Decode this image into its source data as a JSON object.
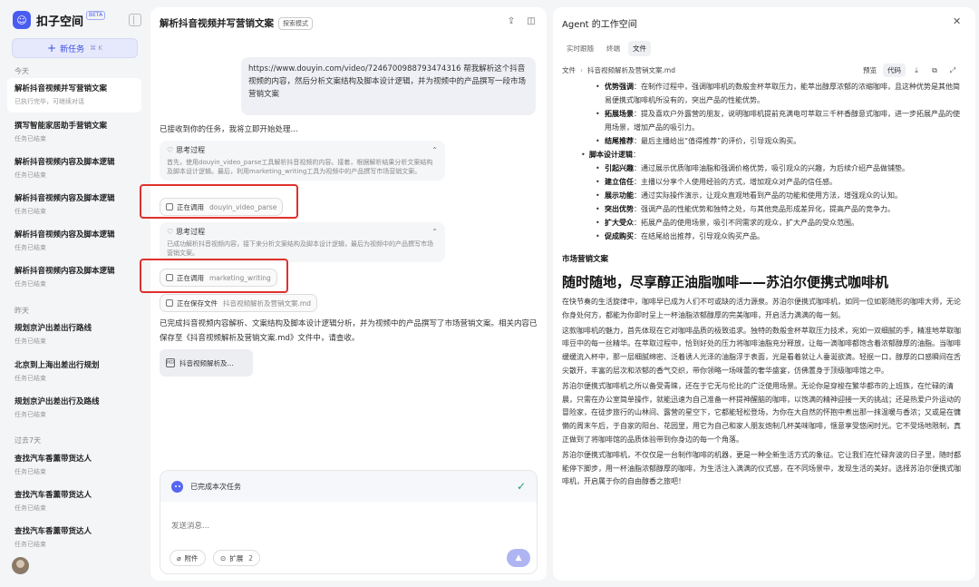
{
  "sidebar": {
    "app_name": "扣子空间",
    "beta": "BETA",
    "new_task": "新任务",
    "new_task_shortcut": "⌘ K",
    "sections": {
      "today": "今天",
      "yesterday": "昨天",
      "past7": "过去7天"
    },
    "tasks": [
      {
        "title": "解析抖音视频并写营销文案",
        "sub": "已执行完毕，可继续对话"
      },
      {
        "title": "撰写智能家居助手营销文案",
        "sub": "任务已结束"
      },
      {
        "title": "解析抖音视频内容及脚本逻辑",
        "sub": "任务已结束"
      },
      {
        "title": "解析抖音视频内容及脚本逻辑",
        "sub": "任务已结束"
      },
      {
        "title": "解析抖音视频内容及脚本逻辑",
        "sub": "任务已结束"
      },
      {
        "title": "解析抖音视频内容及脚本逻辑",
        "sub": "任务已结束"
      },
      {
        "title": "规划京沪出差出行路线",
        "sub": "任务已结束"
      },
      {
        "title": "北京到上海出差出行规划",
        "sub": "任务已结束"
      },
      {
        "title": "规划京沪出差出行及路线",
        "sub": "任务已结束"
      },
      {
        "title": "查找汽车香薰带货达人",
        "sub": "任务已结束"
      },
      {
        "title": "查找汽车香薰带货达人",
        "sub": "任务已结束"
      },
      {
        "title": "查找汽车香薰带货达人",
        "sub": "任务已结束"
      }
    ]
  },
  "chat": {
    "title": "解析抖音视频并写营销文案",
    "mode_badge": "探索模式",
    "user_message": "https://www.douyin.com/video/7246700988793474316 帮我解析这个抖音视频的内容，然后分析文案结构及脚本设计逻辑，并为视频中的产品撰写一段市场营销文案",
    "ack": "已接收到你的任务，我将立即开始处理...",
    "think1_title": "思考过程",
    "think1_body": "首先，使用douyin_video_parse工具解析抖音视频的内容。接着，根据解析结果分析文案结构及脚本设计逻辑。最后，利用marketing_writing工具为视频中的产品撰写市场营销文案。",
    "tool1_label": "正在调用",
    "tool1_name": "douyin_video_parse",
    "think2_title": "思考过程",
    "think2_body": "已成功解析抖音视频内容，接下来分析文案结构及脚本设计逻辑，最后为视频中的产品撰写市场营销文案。",
    "tool2_label": "正在调用",
    "tool2_name": "marketing_writing",
    "tool3_label": "正在保存文件",
    "tool3_name": "抖音视频解析及营销文案.md",
    "summary": "已完成抖音视频内容解析、文案结构及脚本设计逻辑分析，并为视频中的产品撰写了市场营销文案。相关内容已保存至《抖音视频解析及营销文案.md》文件中，请查收。",
    "file_card": "抖音视频解析及...",
    "status": "已完成本次任务",
    "input_placeholder": "发送消息...",
    "attach": "附件",
    "extend": "扩展",
    "extend_count": "2"
  },
  "agent": {
    "title": "Agent 的工作空间",
    "tabs": [
      "实时跟随",
      "终端",
      "文件"
    ],
    "active_tab": 2,
    "crumb_root": "文件",
    "crumb_file": "抖音视频解析及营销文案.md",
    "view_preview": "预览",
    "view_code": "代码",
    "doc": {
      "top_bullets": [
        {
          "label": "优势强调",
          "text": "：在制作过程中，强调咖啡机的数般金杯萃取压力，能萃出醇厚浓郁的浓缩咖啡，且这种优势是其他简易便携式咖啡机所没有的，突出产品的性能优势。"
        },
        {
          "label": "拓展场景",
          "text": "：提及喜欢户外露营的朋友，说明咖啡机提前充满电可萃取三千杯香醇意式咖啡，进一步拓展产品的使用场景，增加产品的吸引力。"
        },
        {
          "label": "结尾推荐",
          "text": "：最后主播给出“值得推荐”的评价，引导观众购买。"
        }
      ],
      "logic_title": "脚本设计逻辑",
      "logic_bullets": [
        {
          "label": "引起兴趣",
          "text": "：通过展示优质咖啡油脂和强调价格优势，吸引观众的兴趣，为后续介绍产品做铺垫。"
        },
        {
          "label": "建立信任",
          "text": "：主播以分享个人使用经验的方式，增加观众对产品的信任感。"
        },
        {
          "label": "展示功能",
          "text": "：通过实际操作演示，让观众直观地看到产品的功能和使用方法，增强观众的认知。"
        },
        {
          "label": "突出优势",
          "text": "：强调产品的性能优势和独特之处，与其他竞品形成差异化，提高产品的竞争力。"
        },
        {
          "label": "扩大受众",
          "text": "：拓展产品的使用场景，吸引不同需求的观众，扩大产品的受众范围。"
        },
        {
          "label": "促成购买",
          "text": "：在结尾给出推荐，引导观众购买产品。"
        }
      ],
      "section_title": "市场营销文案",
      "headline": "随时随地，尽享醇正油脂咖啡——苏泊尔便携式咖啡机",
      "paragraphs": [
        "在快节奏的生活旋律中，咖啡早已成为人们不可或缺的活力源泉。苏泊尔便携式咖啡机，如同一位如影随形的咖啡大师，无论你身处何方，都能为你即时呈上一杯油脂浓郁醇厚的完美咖啡，开启活力满满的每一刻。",
        "这款咖啡机的魅力，首先体现在它对咖啡品质的极致追求。独特的数般金杯萃取压力技术，宛如一双细腻的手，精准地萃取咖啡豆中的每一丝精华。在萃取过程中，恰到好处的压力将咖啡油脂充分释放，让每一滴咖啡都饱含着浓郁醇厚的油脂。当咖啡缓缓流入杯中，那一层细腻绵密、泛着诱人光泽的油脂浮于表面，光是看着就让人垂涎欲滴。轻抿一口，醇厚的口感瞬间在舌尖散开，丰富的层次和浓郁的香气交织，带你领略一场味蕾的奢华盛宴，仿佛置身于顶级咖啡馆之中。",
        "苏泊尔便携式咖啡机之所以备受青睐，还在于它无与伦比的广泛使用场景。无论你是穿梭在繁华都市的上班族，在忙碌的清晨，只需在办公室简单操作，就能迅速为自己准备一杯提神醒脑的咖啡，以饱满的精神迎接一天的挑战；还是热爱户外运动的冒险家，在徒步旅行的山林间、露营的星空下，它都能轻松登场，为你在大自然的怀抱中煮出那一抹温暖与香浓；又或是在慵懒的周末午后，于自家的阳台、花园里，用它为自己和家人朋友炮制几杯美味咖啡，惬意享受悠闲时光。它不受场地限制，真正做到了将咖啡馆的品质体验带到你身边的每一个角落。",
        "苏泊尔便携式咖啡机，不仅仅是一台制作咖啡的机器，更是一种全新生活方式的象征。它让我们在忙碌奔波的日子里，随时都能停下脚步，用一杯油脂浓郁醇厚的咖啡，为生活注入满满的仪式感，在不同场景中，发现生活的美好。选择苏泊尔便携式咖啡机，开启属于你的自由醇香之旅吧！"
      ]
    }
  }
}
